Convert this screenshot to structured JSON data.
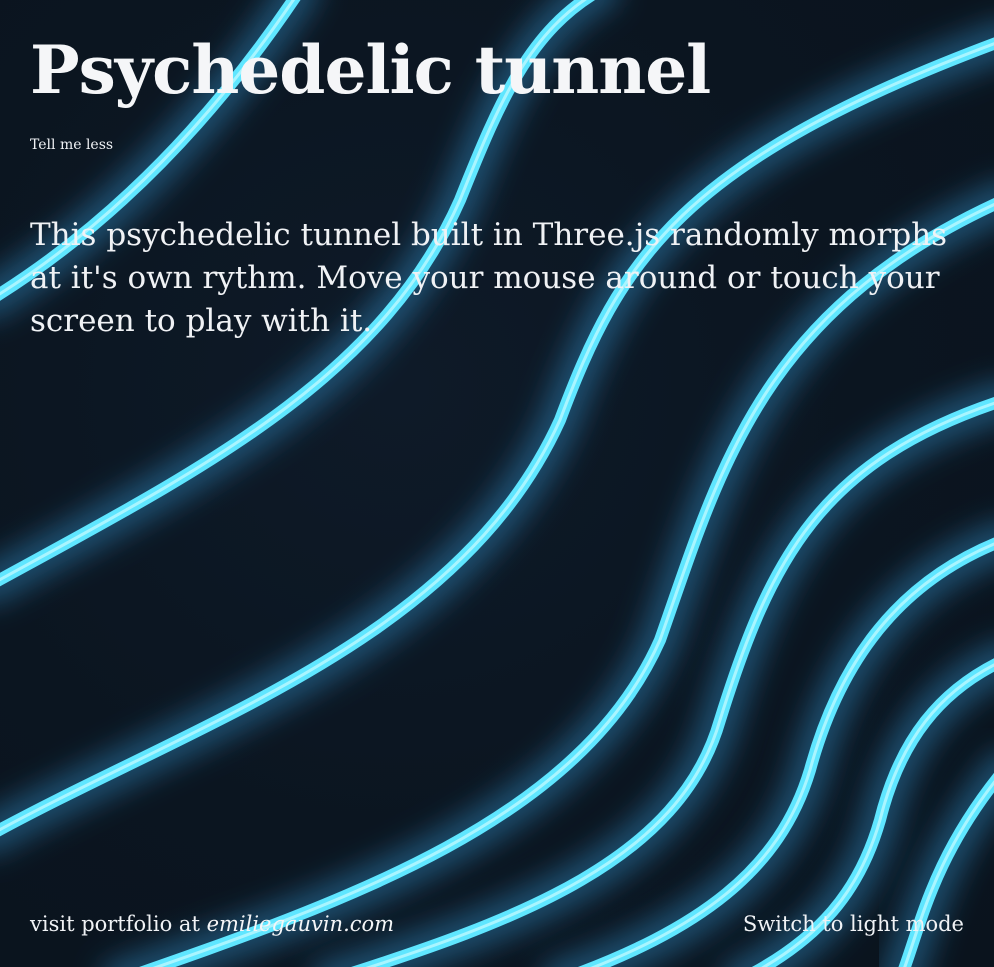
{
  "page": {
    "title": "Psychedelic tunnel",
    "toggle_info_label": "Tell me less",
    "description": "This psychedelic tunnel built in Three.js randomly morphs at it's own rythm. Move your mouse around or touch your screen to play with it."
  },
  "footer": {
    "portfolio_prefix": "visit portfolio at ",
    "portfolio_link": "emiliegauvin.com",
    "theme_toggle_label": "Switch to light mode"
  },
  "colors": {
    "background": "#0c1622",
    "tube": "#5fe6ff",
    "glow": "#3fb8ff",
    "text": "#f0f2f5"
  }
}
